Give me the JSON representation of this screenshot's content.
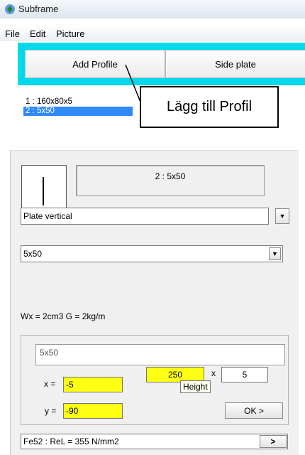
{
  "window": {
    "title": "Subframe"
  },
  "menu": [
    "File",
    "Edit",
    "Picture"
  ],
  "toolbar": {
    "add_profile": "Add Profile",
    "side_plate": "Side plate"
  },
  "profile_list": [
    "1 : 160x80x5",
    "2 : 5x50"
  ],
  "callout": "Lägg till Profil",
  "panel": {
    "profile_name": "2 : 5x50",
    "type": "Plate vertical",
    "size": "5x50",
    "properties": "Wx = 2cm3   G = 2kg/m",
    "description": "5x50",
    "x_label": "x =",
    "x_value": "-5",
    "y_label": "y =",
    "y_value": "-90",
    "height": "250",
    "times": "x",
    "width": "5",
    "tooltip": "Height",
    "ok": "OK >",
    "material": "Fe52 : ReL = 355 N/mm2",
    "material_button": ">"
  },
  "colors": {
    "toolbar": "#00d9ec",
    "highlight": "#2f8af8",
    "input_yellow": "#ffff14"
  }
}
